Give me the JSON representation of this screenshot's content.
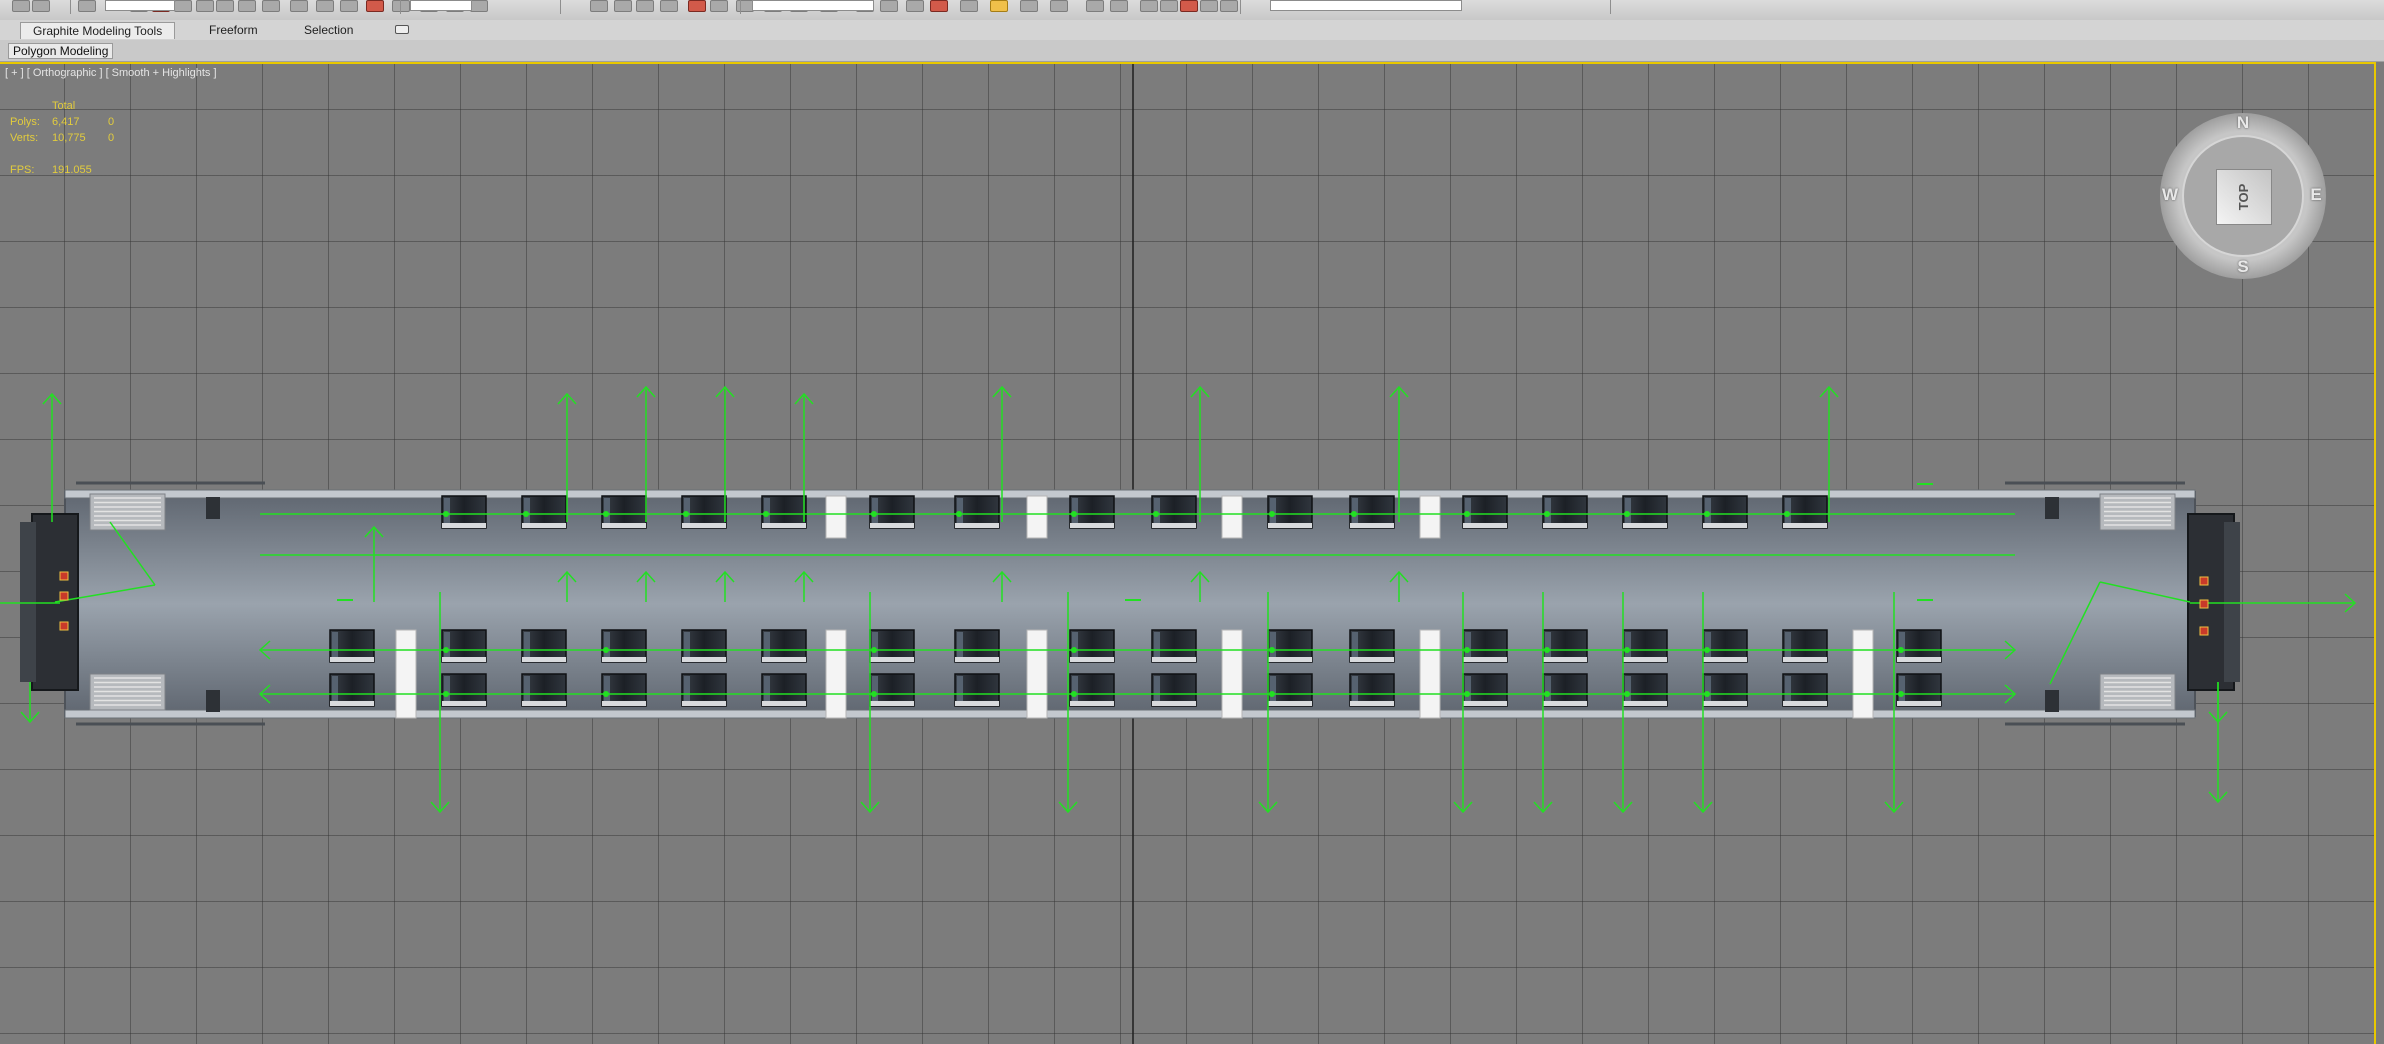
{
  "ribbon": {
    "tabs": [
      {
        "label": "Graphite Modeling Tools"
      },
      {
        "label": "Freeform"
      },
      {
        "label": "Selection"
      }
    ],
    "panel_label": "Polygon Modeling"
  },
  "viewport": {
    "label": "[ + ] [ Orthographic ] [ Smooth + Highlights ]",
    "stats": {
      "header": "Total",
      "polys_label": "Polys:",
      "polys_total": "6,417",
      "polys_selected": "0",
      "verts_label": "Verts:",
      "verts_total": "10,775",
      "verts_selected": "0",
      "fps_label": "FPS:",
      "fps_value": "191.055"
    }
  },
  "viewcube": {
    "face": "TOP",
    "compass": [
      "N",
      "E",
      "S",
      "W"
    ]
  },
  "colors": {
    "viewport_bg": "#7c7c7c",
    "active_border": "#e8c800",
    "helper_green": "#22e022",
    "stats_text": "#e2cc3d"
  }
}
